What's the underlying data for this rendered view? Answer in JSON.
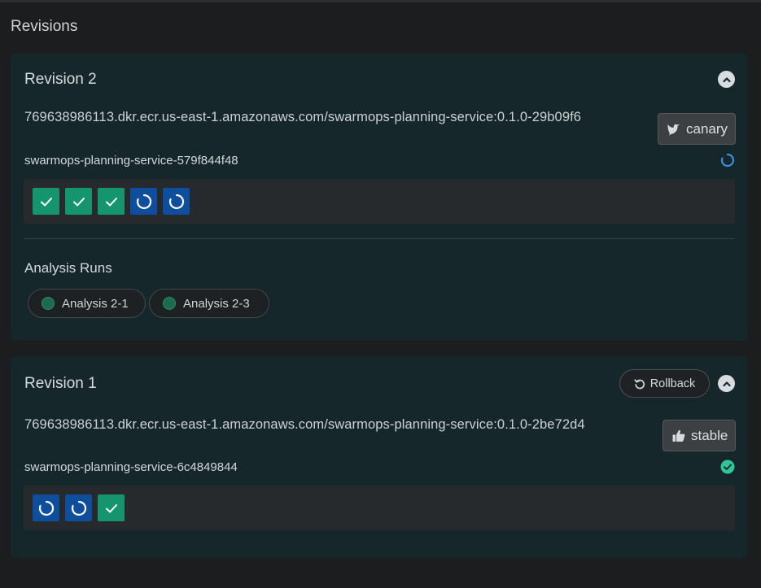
{
  "section_title": "Revisions",
  "revisions": [
    {
      "title": "Revision 2",
      "image": "769638986113.dkr.ecr.us-east-1.amazonaws.com/swarmops-planning-service:0.1.0-29b09f6",
      "tag": "canary",
      "tag_icon": "bird-icon",
      "replicaset": "swarmops-planning-service-579f844f48",
      "replicaset_status": "progressing",
      "pods": [
        "ok",
        "ok",
        "ok",
        "pending",
        "pending"
      ],
      "analysis_title": "Analysis Runs",
      "analysis_runs": [
        "Analysis 2-1",
        "Analysis 2-3"
      ]
    },
    {
      "title": "Revision 1",
      "rollback_label": "Rollback",
      "image": "769638986113.dkr.ecr.us-east-1.amazonaws.com/swarmops-planning-service:0.1.0-2be72d4",
      "tag": "stable",
      "tag_icon": "thumbs-up-icon",
      "replicaset": "swarmops-planning-service-6c4849844",
      "replicaset_status": "healthy",
      "pods": [
        "pending",
        "pending",
        "ok"
      ]
    }
  ],
  "colors": {
    "background": "#1b1d1f",
    "card": "#15272a",
    "pod_ok": "#14956e",
    "pod_pending": "#0f4e9c",
    "status_progressing": "#3d8fd6",
    "status_healthy": "#2fc798"
  }
}
